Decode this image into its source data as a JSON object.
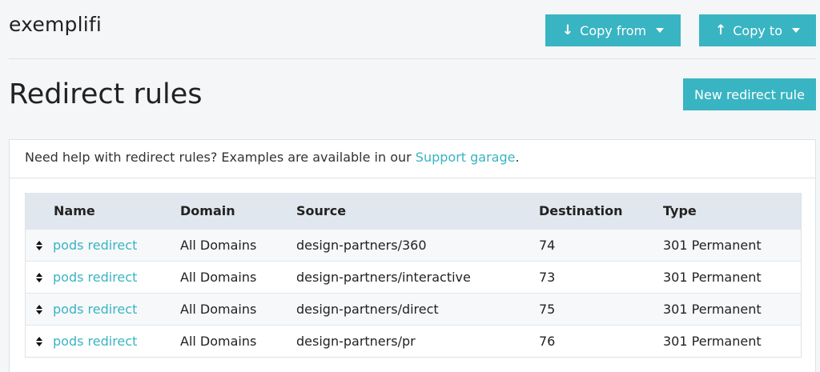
{
  "app": {
    "brand": "exemplifi"
  },
  "toolbar": {
    "copy_from_label": "Copy from",
    "copy_to_label": "Copy to",
    "accent_color": "#39b4c2"
  },
  "page": {
    "title": "Redirect rules",
    "new_button_label": "New redirect rule"
  },
  "help": {
    "text": "Need help with redirect rules? Examples are available in our ",
    "link_text": "Support garage",
    "suffix": "."
  },
  "table": {
    "headers": {
      "name": "Name",
      "domain": "Domain",
      "source": "Source",
      "destination": "Destination",
      "type": "Type"
    },
    "rows": [
      {
        "name": "pods redirect",
        "domain": "All Domains",
        "source": "design-partners/360",
        "destination": "74",
        "type": "301 Permanent"
      },
      {
        "name": "pods redirect",
        "domain": "All Domains",
        "source": "design-partners/interactive",
        "destination": "73",
        "type": "301 Permanent"
      },
      {
        "name": "pods redirect",
        "domain": "All Domains",
        "source": "design-partners/direct",
        "destination": "75",
        "type": "301 Permanent"
      },
      {
        "name": "pods redirect",
        "domain": "All Domains",
        "source": "design-partners/pr",
        "destination": "76",
        "type": "301 Permanent"
      }
    ]
  },
  "icons": {
    "copy_from": "arrow-down-icon",
    "copy_to": "arrow-up-icon",
    "dropdown": "caret-down-icon",
    "reorder": "sort-handle-icon"
  }
}
